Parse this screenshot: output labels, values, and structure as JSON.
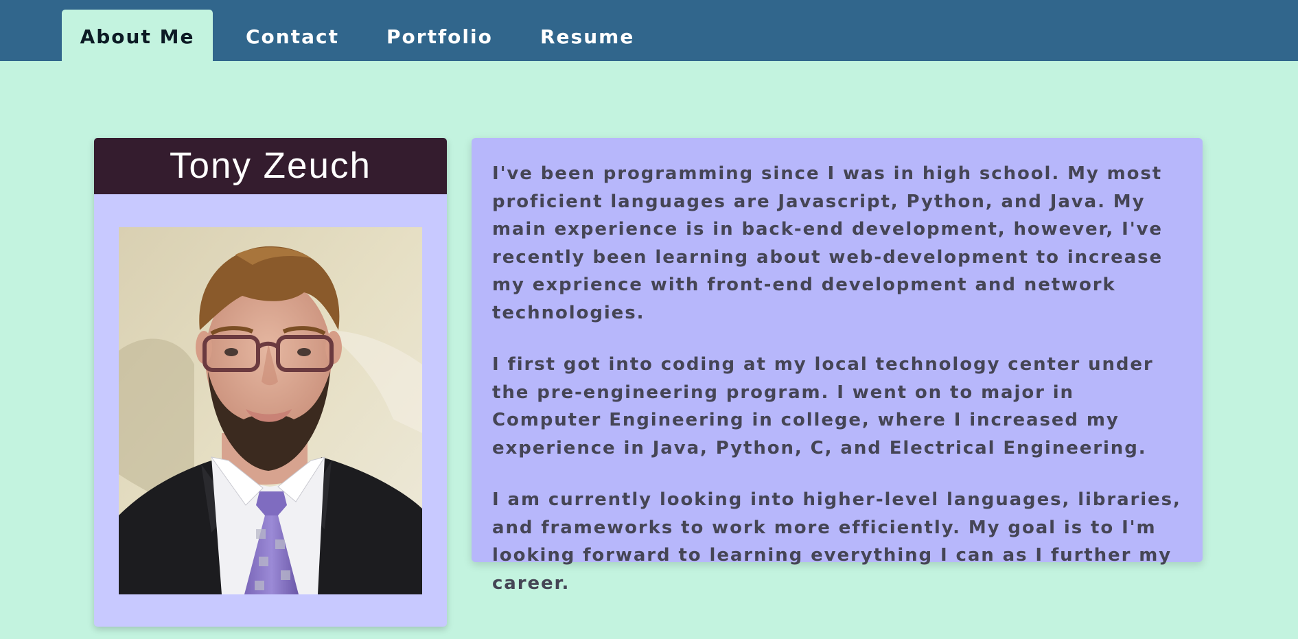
{
  "nav": {
    "tabs": [
      {
        "label": "About Me",
        "active": true
      },
      {
        "label": "Contact",
        "active": false
      },
      {
        "label": "Portfolio",
        "active": false
      },
      {
        "label": "Resume",
        "active": false
      }
    ]
  },
  "profile": {
    "name": "Tony Zeuch"
  },
  "bio": {
    "paragraphs": [
      "I've been programming since I was in high school. My most proficient languages are Javascript, Python, and Java. My main experience is in back-end development, however, I've recently been learning about web-development to increase my exprience with front-end development and network technologies.",
      "I first got into coding at my local technology center under the pre-engineering program. I went on to major in Computer Engineering in college, where I increased my experience in Java, Python, C, and Electrical Engineering.",
      "I am currently looking into higher-level languages, libraries, and frameworks to work more efficiently. My goal is to I'm looking forward to learning everything I can as I further my career."
    ]
  },
  "colors": {
    "navbar": "#31668c",
    "page_background": "#c3f3df",
    "card_header": "#341c2e",
    "card_body": "#c8c9ff",
    "bio_panel": "#b7b7fb"
  }
}
